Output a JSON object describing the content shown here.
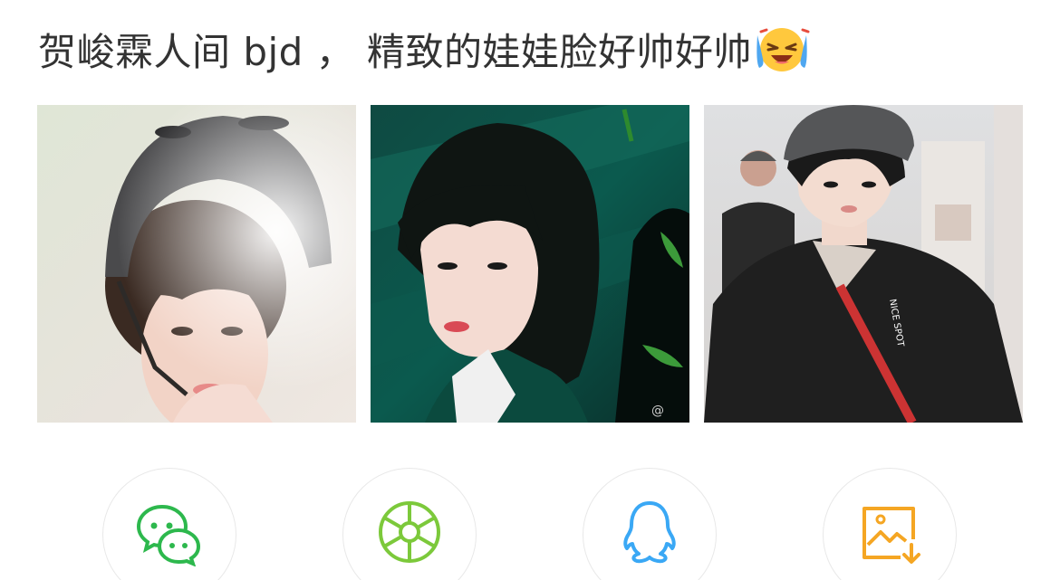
{
  "post": {
    "text": "贺峻霖人间 bjd ， 精致的娃娃脸好帅好帅",
    "emoji": "crying-laughing-emoji"
  },
  "photos": [
    {
      "name": "photo-helmet-portrait"
    },
    {
      "name": "photo-green-background-portrait"
    },
    {
      "name": "photo-airport-portrait",
      "jacket_text": "NICE SPOT"
    }
  ],
  "share": {
    "items": [
      {
        "icon": "wechat-icon",
        "color": "#2DB84D"
      },
      {
        "icon": "moments-shutter-icon",
        "color": "#7CC93B"
      },
      {
        "icon": "qq-penguin-icon",
        "color": "#3AA8F5"
      },
      {
        "icon": "save-image-icon",
        "color": "#F5A623"
      }
    ]
  }
}
